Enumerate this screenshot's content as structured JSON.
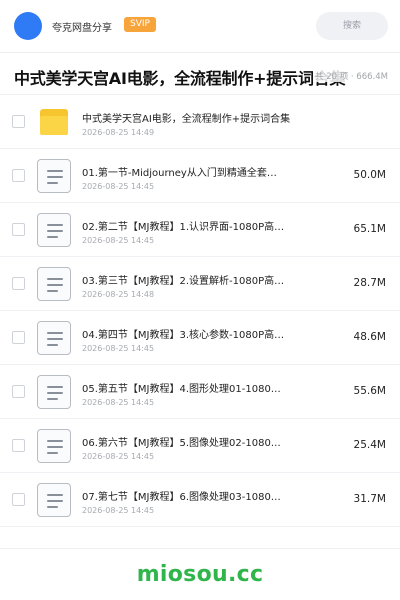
{
  "header": {
    "share_name": "夸克网盘分享",
    "badge": "SVIP",
    "search_label": "搜索"
  },
  "title": {
    "text": "中式美学天宫AI电影，全流程制作+提示词合集",
    "meta": "共 20 项 · 666.4M"
  },
  "files": [
    {
      "type": "folder",
      "name": "中式美学天宫AI电影，全流程制作+提示词合集",
      "date": "2026-08-25 14:49",
      "size": ""
    },
    {
      "type": "file",
      "name": "01.第一节-Midjourney从入门到精通全套…",
      "date": "2026-08-25 14:45",
      "size": "50.0M"
    },
    {
      "type": "file",
      "name": "02.第二节【MJ教程】1.认识界面-1080P高…",
      "date": "2026-08-25 14:45",
      "size": "65.1M"
    },
    {
      "type": "file",
      "name": "03.第三节【MJ教程】2.设置解析-1080P高…",
      "date": "2026-08-25 14:48",
      "size": "28.7M"
    },
    {
      "type": "file",
      "name": "04.第四节【MJ教程】3.核心参数-1080P高…",
      "date": "2026-08-25 14:45",
      "size": "48.6M"
    },
    {
      "type": "file",
      "name": "05.第五节【MJ教程】4.图形处理01-1080…",
      "date": "2026-08-25 14:45",
      "size": "55.6M"
    },
    {
      "type": "file",
      "name": "06.第六节【MJ教程】5.图像处理02-1080…",
      "date": "2026-08-25 14:45",
      "size": "25.4M"
    },
    {
      "type": "file",
      "name": "07.第七节【MJ教程】6.图像处理03-1080…",
      "date": "2026-08-25 14:45",
      "size": "31.7M"
    }
  ],
  "watermark": "miosou.cc",
  "colors": {
    "avatar": "#2f7bf5",
    "badge": "#f7a43b",
    "folder": "#f6c530",
    "watermark": "#2fb54a"
  }
}
